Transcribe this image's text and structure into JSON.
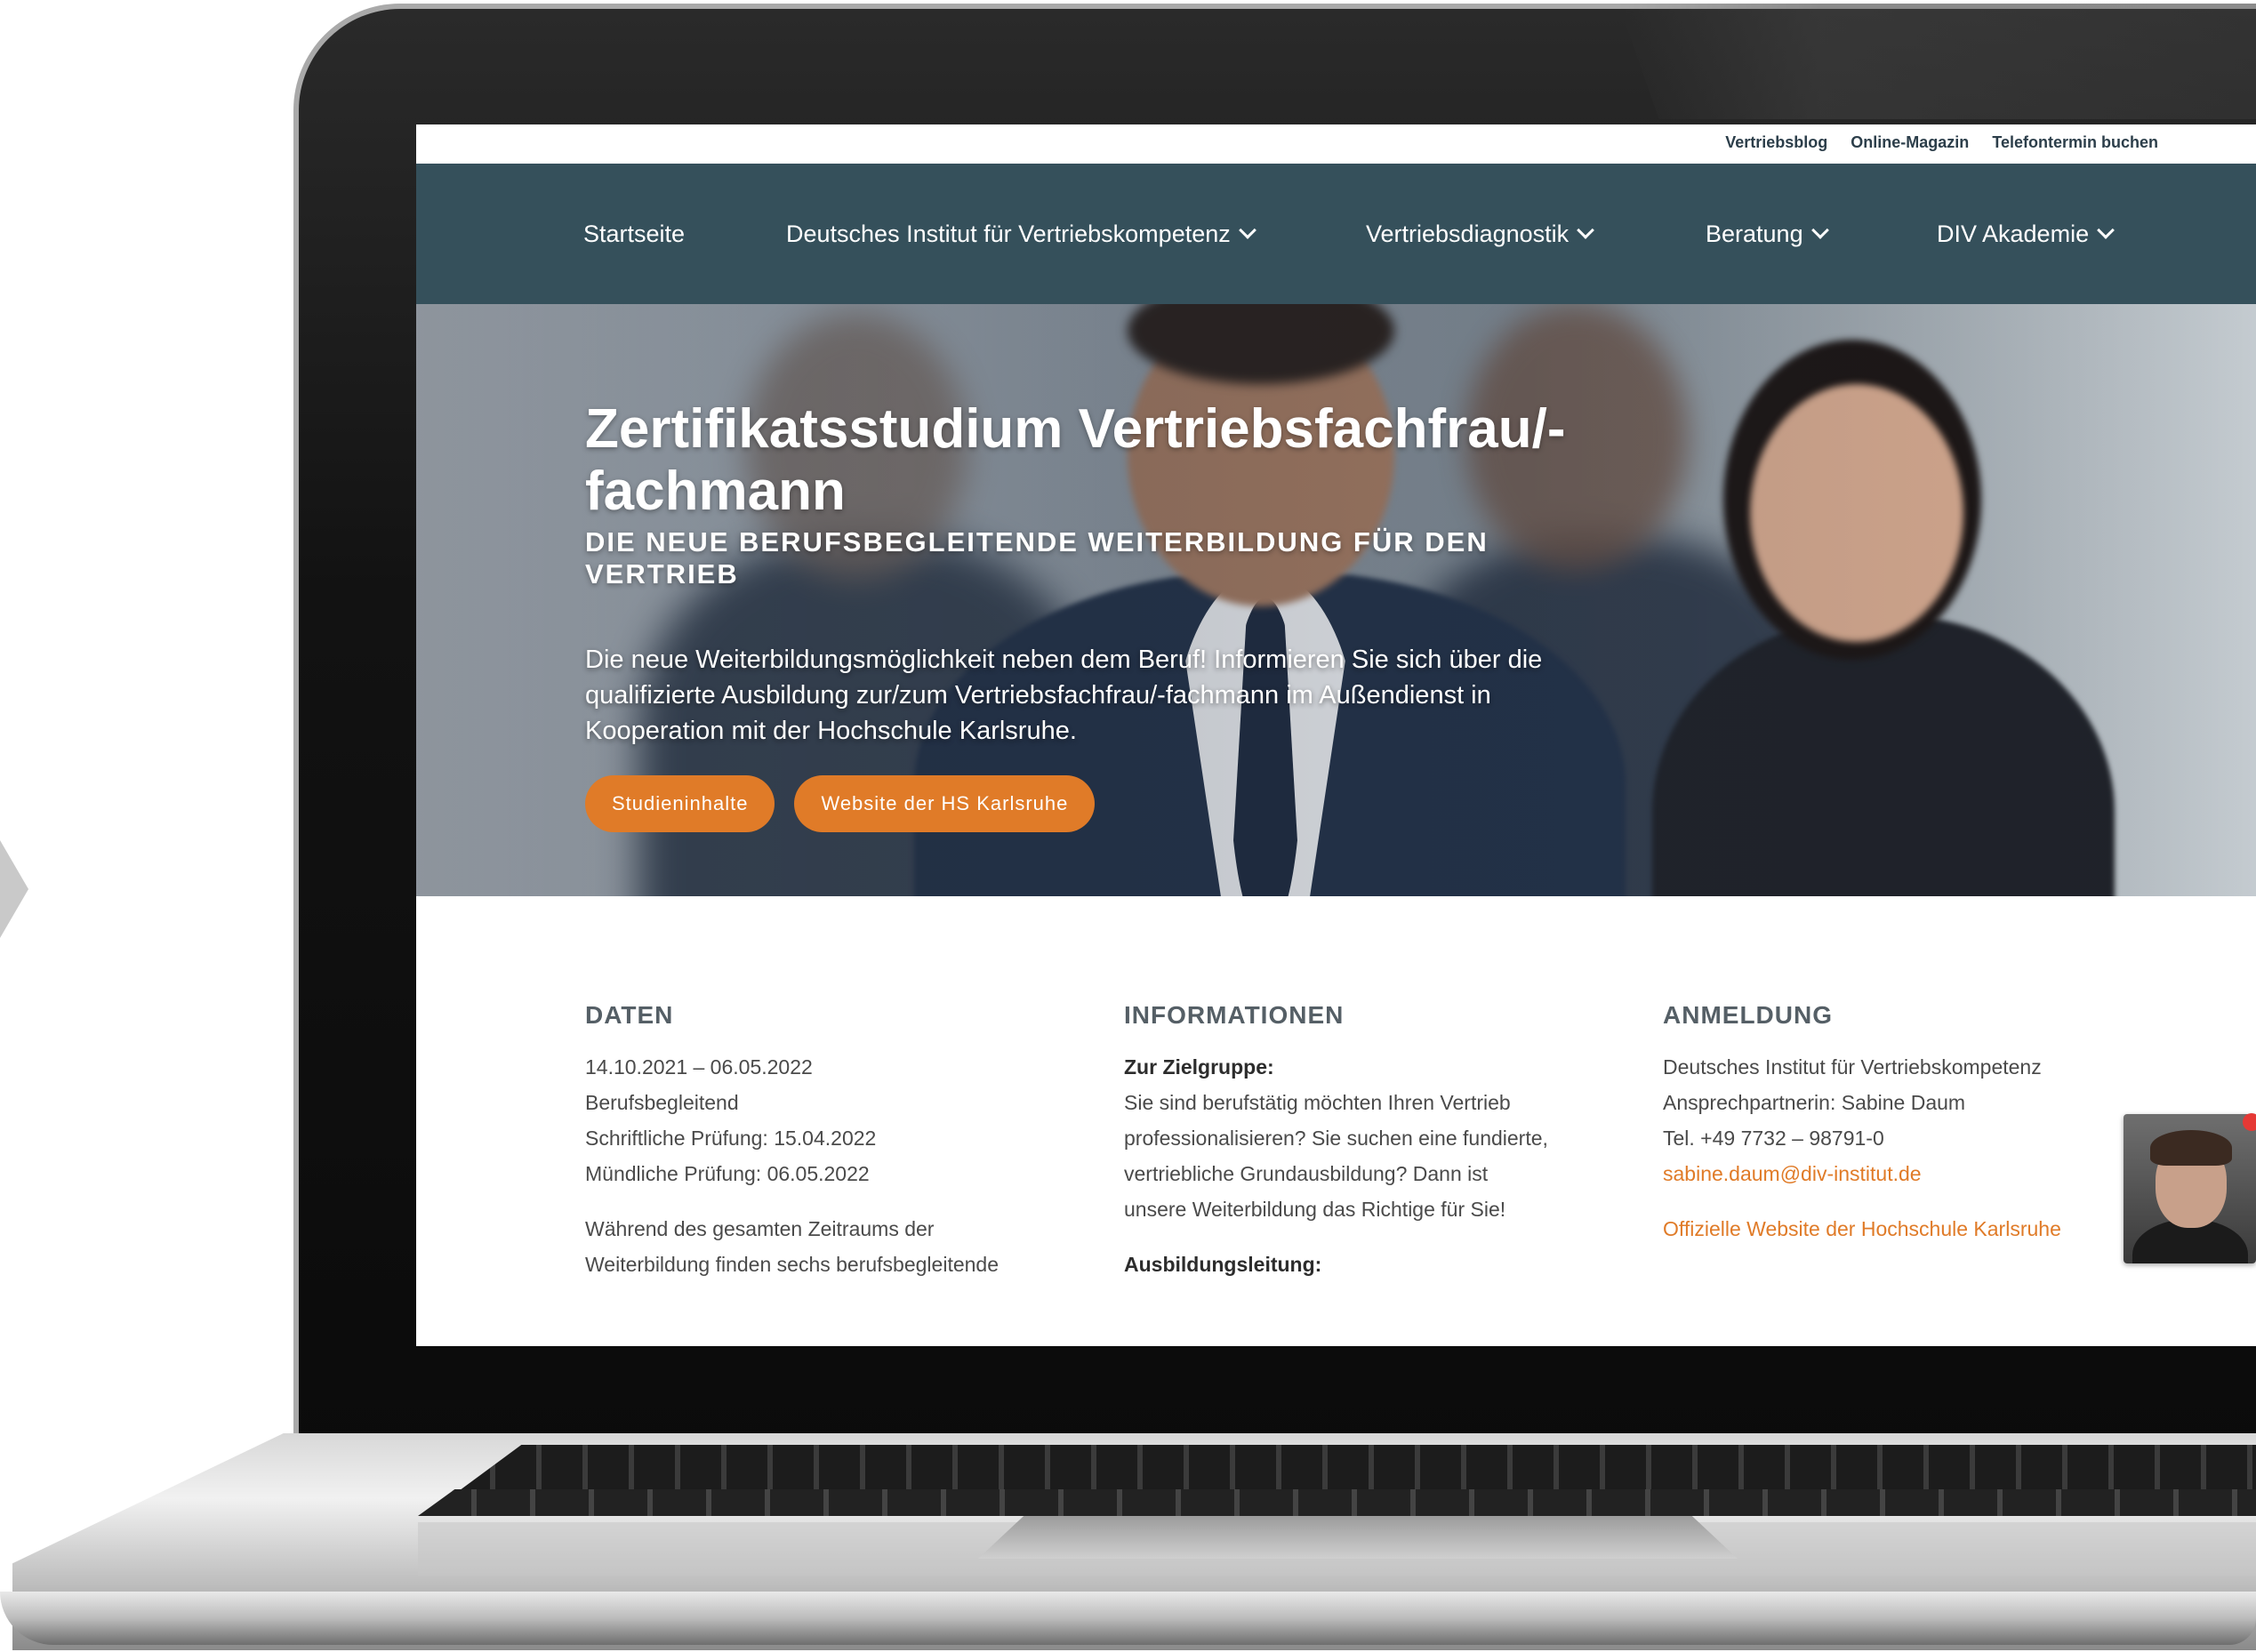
{
  "top_links": [
    "Vertriebsblog",
    "Online-Magazin",
    "Telefontermin buchen"
  ],
  "nav": [
    {
      "label": "Startseite",
      "dropdown": false
    },
    {
      "label": "Deutsches Institut für Vertriebskompetenz",
      "dropdown": true
    },
    {
      "label": "Vertriebsdiagnostik",
      "dropdown": true
    },
    {
      "label": "Beratung",
      "dropdown": true
    },
    {
      "label": "DIV Akademie",
      "dropdown": true
    }
  ],
  "hero": {
    "title_line1": "Zertifikatsstudium Vertriebsfachfrau/-",
    "title_line2": "fachmann",
    "subtitle": "DIE NEUE BERUFSBEGLEITENDE WEITERBILDUNG FÜR DEN VERTRIEB",
    "text": "Die neue Weiterbildungsmöglichkeit neben dem Beruf! Informieren Sie sich über die qualifizierte Ausbildung zur/zum Vertriebsfachfrau/-fachmann im Außendienst in Kooperation mit der Hochschule Karlsruhe.",
    "button_1": "Studieninhalte",
    "button_2": "Website der HS Karlsruhe"
  },
  "daten": {
    "heading": "DATEN",
    "lines": [
      "14.10.2021 – 06.05.2022",
      "Berufsbegleitend",
      "Schriftliche Prüfung: 15.04.2022",
      "Mündliche Prüfung: 06.05.2022"
    ],
    "para_line1": "Während des gesamten Zeitraums der",
    "para_line2": "Weiterbildung finden sechs berufsbegleitende"
  },
  "informationen": {
    "heading": "INFORMATIONEN",
    "zielgruppe_label": "Zur Zielgruppe:",
    "lines": [
      "Sie sind berufstätig möchten Ihren Vertrieb",
      "professionalisieren? Sie suchen eine fundierte,",
      "vertriebliche Grundausbildung? Dann ist",
      "unsere Weiterbildung das Richtige für Sie!"
    ],
    "leitung_label": "Ausbildungsleitung:"
  },
  "anmeldung": {
    "heading": "ANMELDUNG",
    "lines": [
      "Deutsches Institut für Vertriebskompetenz",
      "Ansprechpartnerin: Sabine Daum",
      "Tel. +49 7732 – 98791-0"
    ],
    "email": "sabine.daum@div-institut.de",
    "website_link": "Offizielle Website der Hochschule Karlsruhe"
  },
  "colors": {
    "nav_bg": "#35505b",
    "accent": "#e07b28",
    "notification": "#e53935"
  },
  "icons": [
    "chevron-down-icon",
    "chat-avatar-photo",
    "notification-dot"
  ]
}
